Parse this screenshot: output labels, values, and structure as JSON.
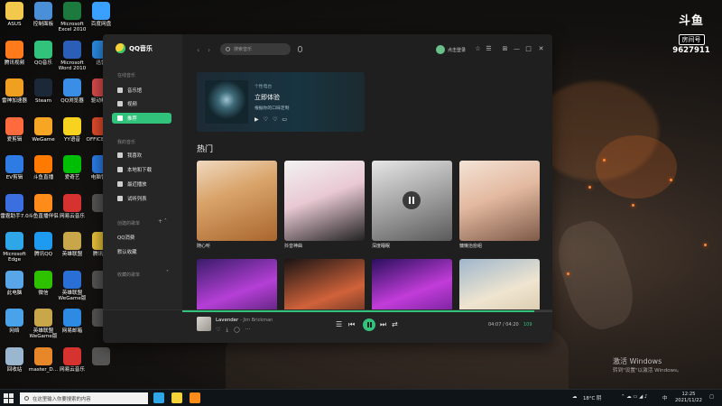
{
  "desktop": {
    "icons": [
      {
        "label": "ASUS",
        "color": "#f2c94c"
      },
      {
        "label": "控制面板",
        "color": "#4a90d9"
      },
      {
        "label": "Microsoft Excel 2010",
        "color": "#1d7a3e"
      },
      {
        "label": "百度网盘",
        "color": "#3aa0ff"
      },
      {
        "label": "腾讯视频",
        "color": "#ff7a1a"
      },
      {
        "label": "QQ音乐",
        "color": "#31c27c"
      },
      {
        "label": "Microsoft Word 2010",
        "color": "#2b5fb7"
      },
      {
        "label": "迅雷",
        "color": "#2a8ae0"
      },
      {
        "label": "雷神加速器",
        "color": "#f0a020"
      },
      {
        "label": "Steam",
        "color": "#1b2838"
      },
      {
        "label": "QQ浏览器",
        "color": "#3a8ee6"
      },
      {
        "label": "驱动精灵",
        "color": "#d94b4b"
      },
      {
        "label": "爱剪辑",
        "color": "#ff6b3d"
      },
      {
        "label": "WeGame",
        "color": "#f7a623"
      },
      {
        "label": "YY语音",
        "color": "#f7d21f"
      },
      {
        "label": "OFFICE 放大",
        "color": "#e14b2b"
      },
      {
        "label": "EV剪辑",
        "color": "#2e7be3"
      },
      {
        "label": "斗鱼直播",
        "color": "#ff7a00"
      },
      {
        "label": "爱奇艺",
        "color": "#00be06"
      },
      {
        "label": "电脑管家",
        "color": "#2b7de9"
      },
      {
        "label": "雷霆助手7.0",
        "color": "#3b6fe0"
      },
      {
        "label": "斗鱼直播伴侣",
        "color": "#ff8c1a"
      },
      {
        "label": "网易云音乐",
        "color": "#d6322f"
      },
      {
        "label": "",
        "color": "#555555"
      },
      {
        "label": "Microsoft Edge",
        "color": "#2fa6e8"
      },
      {
        "label": "腾讯QQ",
        "color": "#1e9bf0"
      },
      {
        "label": "英雄联盟",
        "color": "#c9a64a"
      },
      {
        "label": "腾讯Wi",
        "color": "#e9c23a"
      },
      {
        "label": "此电脑",
        "color": "#58a6e8"
      },
      {
        "label": "微信",
        "color": "#2dc100"
      },
      {
        "label": "英雄联盟 WeGame版",
        "color": "#2a6fd6"
      },
      {
        "label": "",
        "color": "#555555"
      },
      {
        "label": "网络",
        "color": "#4aa3e8"
      },
      {
        "label": "英雄联盟 WeGame版",
        "color": "#c9a64a"
      },
      {
        "label": "网易邮箱",
        "color": "#2d8be3"
      },
      {
        "label": "",
        "color": "#555555"
      },
      {
        "label": "回收站",
        "color": "#9ab7cf"
      },
      {
        "label": "master_D...",
        "color": "#e8862a"
      },
      {
        "label": "网易云音乐",
        "color": "#d6322f"
      },
      {
        "label": "",
        "color": "#555555"
      }
    ]
  },
  "stream_badge": {
    "logo": "斗鱼",
    "room_label": "房间号",
    "room_number": "9627911"
  },
  "window": {
    "app_name": "QQ音乐",
    "sidebar": {
      "online_head": "在线音乐",
      "online_items": [
        "音乐馆",
        "视频",
        "推荐"
      ],
      "mine_head": "我的音乐",
      "mine_items": [
        "我喜欢",
        "本地和下载",
        "最近播放",
        "试听列表"
      ],
      "created_head": "创建的歌单",
      "created_items": [
        "QQ消费",
        "默认收藏"
      ],
      "collected_head": "收藏的歌单"
    },
    "topbar": {
      "back": "‹",
      "forward": "›",
      "search_placeholder": "搜索音乐",
      "login": "点击登录",
      "icons": [
        "☆",
        "☰",
        "⊞",
        "—",
        "□",
        "✕"
      ]
    },
    "banner": {
      "sub": "个性电台",
      "title": "立即体验",
      "desc": "根据你的口味定制",
      "controls": [
        "▶",
        "♡",
        "♡",
        "▭"
      ]
    },
    "section_title": "热门",
    "cards": [
      {
        "label": "随心听",
        "bg": "linear-gradient(160deg,#f0d9c0 0%,#d9a46a 40%,#a9662e 100%)"
      },
      {
        "label": "抖音神曲",
        "bg": "linear-gradient(160deg,#f2f2f2 0%,#e9c9d3 45%,#222 100%)"
      },
      {
        "label": "深度睡眠",
        "bg": "linear-gradient(160deg,#e6e6e6 0%,#9b9b9b 55%,#5a5a5a 100%)"
      },
      {
        "label": "慵懒治愈组",
        "bg": "linear-gradient(160deg,#f4e3d6 0%,#e3b9a0 45%,#7e5a48 100%)"
      },
      {
        "label": "",
        "bg": "linear-gradient(160deg,#3a1c6b 0%,#b53fd6 45%,#1b0f3a 100%)"
      },
      {
        "label": "",
        "bg": "linear-gradient(160deg,#1a1414 0%,#d0623a 50%,#1a1414 100%)"
      },
      {
        "label": "",
        "bg": "linear-gradient(160deg,#2a0f5e 0%,#c23cd9 45%,#3c0f6e 100%)"
      },
      {
        "label": "",
        "bg": "linear-gradient(160deg,#9fb6cc 0%,#efe5d0 45%,#c9b795 100%)"
      }
    ],
    "player": {
      "song": "Lavender",
      "artist": "- Jim Brickman",
      "mini_icons": [
        "♡",
        "⤓",
        "◯",
        "···"
      ],
      "controls": {
        "list": "☰",
        "prev": "⏮",
        "next": "⏭",
        "mode": "⇄"
      },
      "time": "04:07 / 04:20",
      "quality": "109",
      "progress": 0.95,
      "accent": "#31c27c"
    }
  },
  "activation": {
    "title": "激活 Windows",
    "sub": "转到\"设置\"以激活 Windows。"
  },
  "taskbar": {
    "search_placeholder": "在这里输入你要搜索的内容",
    "weather": "18°C 阴",
    "lang": "中",
    "time": "12:25",
    "date": "2021/11/22"
  }
}
